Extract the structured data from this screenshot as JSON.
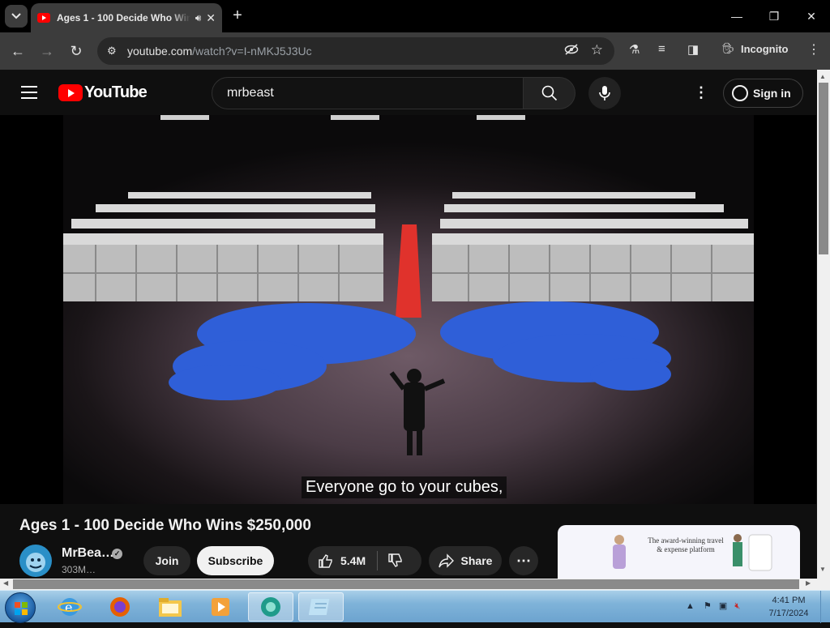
{
  "browser": {
    "tab_title": "Ages 1 - 100 Decide Who Wins $250,000",
    "url_domain": "youtube.com",
    "url_path": "/watch?v=I-nMKJ5J3Uc",
    "profile_label": "Incognito"
  },
  "youtube": {
    "logo_text": "YouTube",
    "search_value": "mrbeast",
    "sign_in_label": "Sign in"
  },
  "video": {
    "caption": "Everyone go to your cubes,",
    "title": "Ages 1 - 100 Decide Who Wins $250,000",
    "channel_name": "MrBea…",
    "subscriber_count": "303M…",
    "join_label": "Join",
    "subscribe_label": "Subscribe",
    "like_count": "5.4M",
    "share_label": "Share"
  },
  "ad": {
    "text": "The award-winning travel & expense platform"
  },
  "taskbar": {
    "time": "4:41 PM",
    "date": "7/17/2024"
  },
  "colors": {
    "youtube_red": "#ff0000",
    "page_bg": "#0f0f0f",
    "jumpsuit_blue": "#2f5fd8",
    "carpet_red": "#e0322c"
  }
}
